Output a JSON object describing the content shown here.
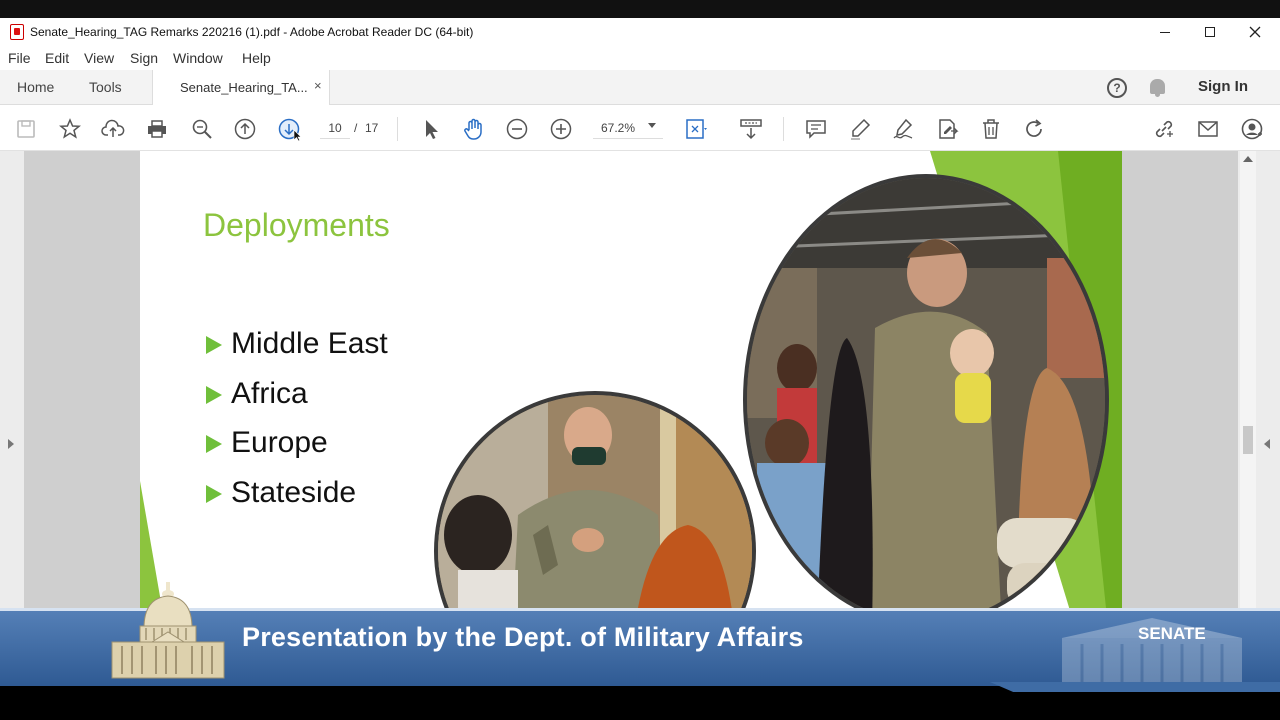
{
  "window": {
    "title": "Senate_Hearing_TAG Remarks 220216 (1).pdf - Adobe Acrobat Reader DC (64-bit)"
  },
  "menu": [
    "File",
    "Edit",
    "View",
    "Sign",
    "Window",
    "Help"
  ],
  "tabs": {
    "home": "Home",
    "tools": "Tools",
    "document": "Senate_Hearing_TA...",
    "close": "×",
    "sign_in": "Sign In",
    "help": "?"
  },
  "toolbar": {
    "page_current": "10",
    "page_separator": "/",
    "page_total": "17",
    "zoom": "67.2%",
    "icons": [
      "save-icon",
      "star-icon",
      "upload-icon",
      "print-icon",
      "search-icon",
      "page-up-icon",
      "page-down-icon",
      "select-cursor-icon",
      "hand-icon",
      "zoom-out-icon",
      "zoom-in-icon",
      "fit-page-icon",
      "scroll-mode-icon",
      "comment-icon",
      "highlight-icon",
      "sign-icon",
      "edit-pdf-icon",
      "delete-icon",
      "rotate-icon",
      "link-icon",
      "mail-icon",
      "account-icon"
    ]
  },
  "slide": {
    "title": "Deployments",
    "bullets": [
      "Middle East",
      "Africa",
      "Europe",
      "Stateside"
    ],
    "accent_color": "#8cc43e"
  },
  "banner": {
    "title": "Presentation by the Dept. of Military Affairs",
    "channel": "SENATE",
    "color": "#3f6ca5"
  }
}
